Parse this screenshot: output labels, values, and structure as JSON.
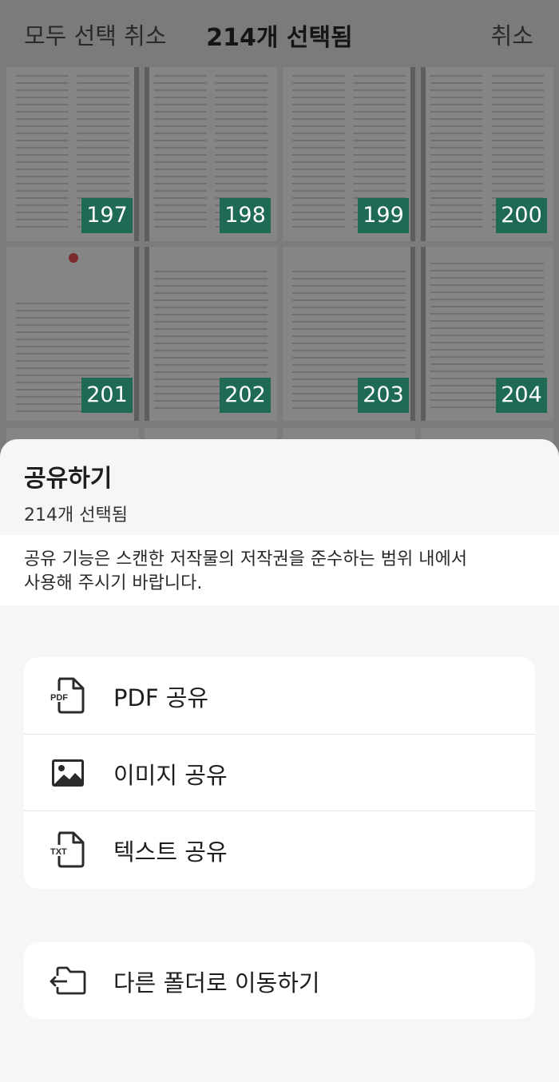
{
  "header": {
    "deselect_all_label": "모두 선택 취소",
    "selected_count_title": "214개 선택됨",
    "cancel_label": "취소"
  },
  "pages": {
    "row1": [
      "197",
      "198",
      "199",
      "200"
    ],
    "row2": [
      "201",
      "202",
      "203",
      "204"
    ]
  },
  "sheet": {
    "title": "공유하기",
    "subtitle": "214개 선택됨",
    "notice_line1": "공유 기능은 스캔한 저작물의 저작권을 준수하는 범위 내에서",
    "notice_line2": "사용해 주시기 바랍니다.",
    "options": {
      "pdf": {
        "label": "PDF 공유",
        "icon": "pdf-file-icon",
        "icon_text": "PDF"
      },
      "image": {
        "label": "이미지 공유",
        "icon": "image-icon"
      },
      "text": {
        "label": "텍스트 공유",
        "icon": "txt-file-icon",
        "icon_text": "TXT"
      }
    },
    "move_folder": {
      "label": "다른 폴더로 이동하기",
      "icon": "folder-move-icon"
    }
  },
  "colors": {
    "page_badge": "#1f6a55",
    "sheet_background": "#f6f6f6",
    "card_background": "#ffffff",
    "overlay_dim": "#7c7c7c"
  }
}
